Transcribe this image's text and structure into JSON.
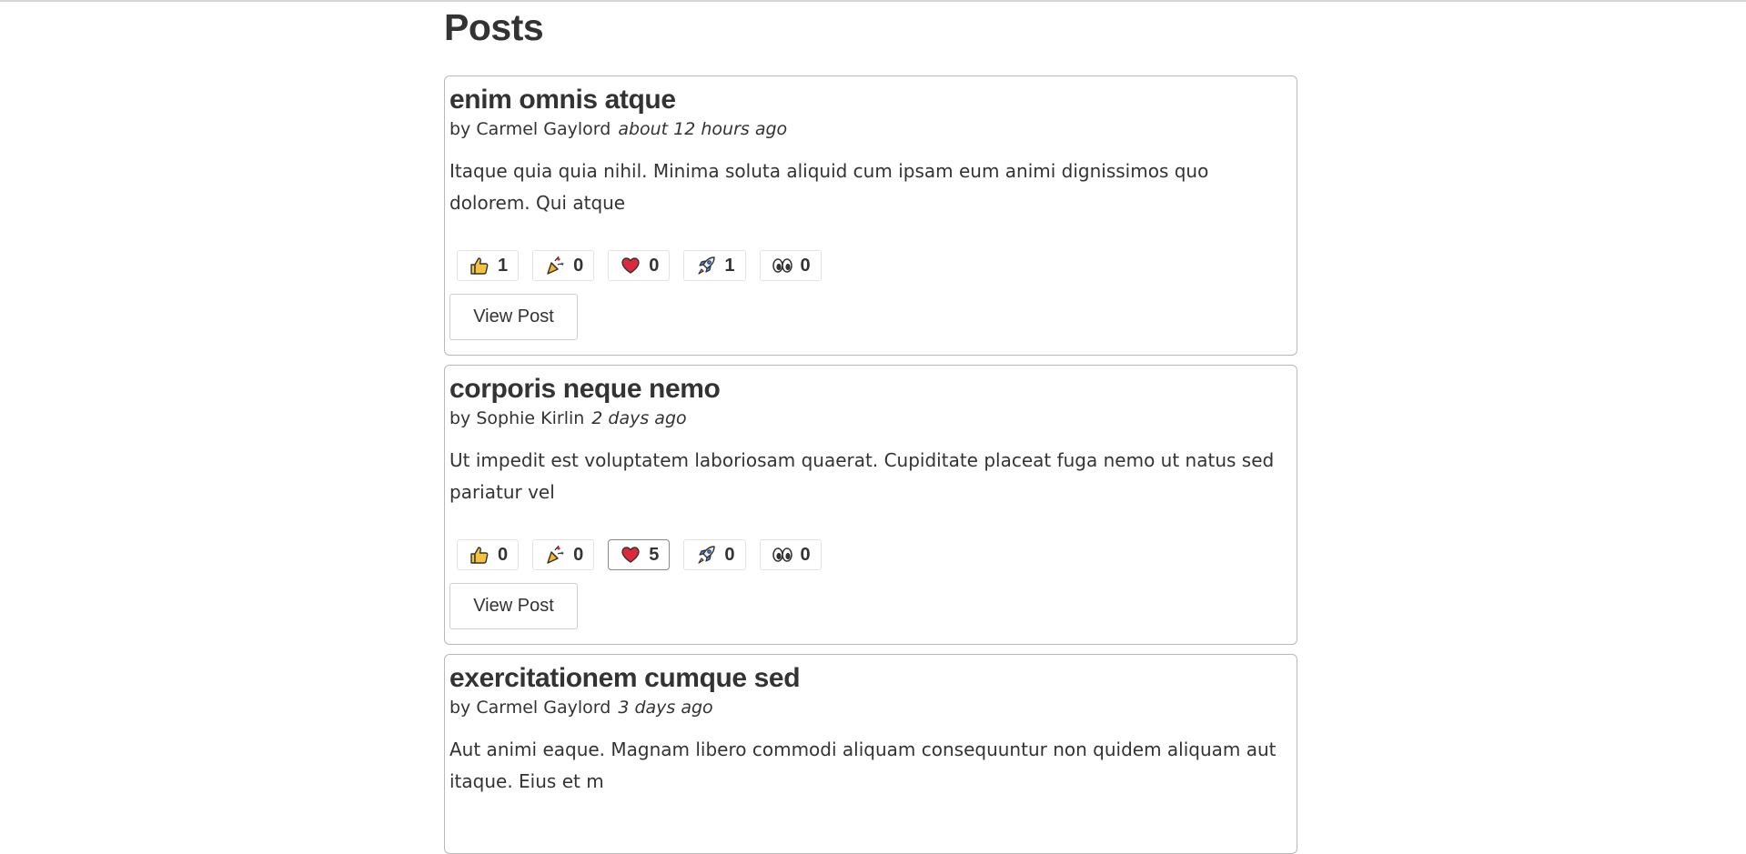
{
  "page": {
    "title": "Posts",
    "view_post_label": "View Post"
  },
  "reaction_icons": [
    "thumbs-up-icon",
    "party-popper-icon",
    "heart-icon",
    "rocket-icon",
    "eyes-icon"
  ],
  "posts": [
    {
      "title": "enim omnis atque",
      "author": "by Carmel Gaylord",
      "time": "about 12 hours ago",
      "excerpt": "Itaque quia quia nihil. Minima soluta aliquid cum ipsam eum animi dignissimos quo dolorem. Qui atque",
      "reactions": {
        "thumbs_up": "1",
        "hooray": "0",
        "heart": "0",
        "rocket": "1",
        "eyes": "0"
      }
    },
    {
      "title": "corporis neque nemo",
      "author": "by Sophie Kirlin",
      "time": "2 days ago",
      "excerpt": "Ut impedit est voluptatem laboriosam quaerat. Cupiditate placeat fuga nemo ut natus sed pariatur vel",
      "reactions": {
        "thumbs_up": "0",
        "hooray": "0",
        "heart": "5",
        "rocket": "0",
        "eyes": "0"
      }
    },
    {
      "title": "exercitationem cumque sed",
      "author": "by Carmel Gaylord",
      "time": "3 days ago",
      "excerpt": "Aut animi eaque. Magnam libero commodi aliquam consequuntur non quidem aliquam aut itaque. Eius et m"
    }
  ],
  "colors": {
    "text": "#333333",
    "border": "#b9b9b9",
    "heart": "#e0283c",
    "thumb": "#f5c33b"
  }
}
